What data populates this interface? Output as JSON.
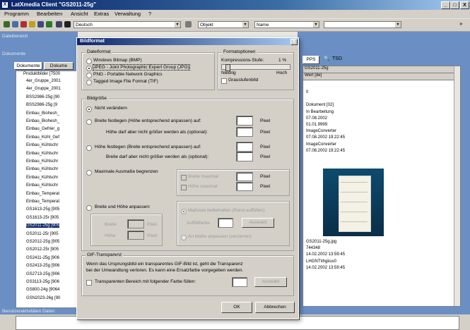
{
  "window": {
    "title": "LatXmedia Client \"GS2011-25g\"",
    "minimize": "_",
    "maximize": "□",
    "close": "X"
  },
  "menu": [
    "Programm",
    "Bearbeiten",
    "Ansicht",
    "Extras",
    "Verwaltung",
    "?"
  ],
  "toolbar": {
    "language": "Deutsch",
    "object": "Objekt",
    "name": "Name",
    "arrow": "»"
  },
  "left_panel": {
    "header1": "Dateibereich",
    "header2": "Dokumente",
    "tabs": [
      "Dokumente",
      "Dokume"
    ],
    "tree_root": "Produktbilder [7500",
    "tree_items": [
      "4er_Gruppe_2001",
      "4er_Gruppe_2001",
      "BSS2986-25g [90",
      "BSS2986-25g [9",
      "Einbau_Biohesh_",
      "Einbau_Biohesh_",
      "Einbau_Gefrier_g",
      "Einbau_Kühl_Gef",
      "Einbau_Kühlschr",
      "Einbau_Kühlschr",
      "Einbau_Kühlschr",
      "Einbau_Kühlschr",
      "Einbau_Kühlschr",
      "Einbau_Kühlschr",
      "Einbau_Temperat",
      "Einbau_Temperat",
      "GS1613-25g [905",
      "GS1613-25r [905",
      "GS2011-25g [905",
      "GS2011-25r [905",
      "GS2012-25g [905",
      "GS2012-25r [905",
      "GS2411-25g [906",
      "GS2413-25g [906",
      "GS2713-25g [906",
      "GS3113-25g [906",
      "GS800-24g [9064",
      "GSN2023-26g [90"
    ],
    "selected_index": 18
  },
  "right_panel": {
    "buttons": [
      "PPS",
      "TSD"
    ],
    "col_header_top": "GS2011-25g",
    "col_header_sub": "Wert [de]",
    "values_top": [
      "0",
      "",
      "Dokument [02]",
      "In Bearbeitung",
      "07.08.2002",
      "01.01.9999",
      "ImageConverter",
      "07.08.2002 19:22:45",
      "ImageConverter",
      "07.08.2002 19:22:45"
    ],
    "values_bottom": [
      "GS2011-25g.jpg",
      "744348",
      "14.02.2002 13:59:45",
      "LHGNT\\thgkus0",
      "14.02.2002 13:59:45"
    ]
  },
  "status_bar": {
    "label": "Benutzeraktivitäten Daten"
  },
  "dialog": {
    "title": "Bildformat",
    "close": "x",
    "dateiformat": {
      "label": "Dateiformat",
      "options": [
        "Windows Bitmap (BMP)",
        "JPEG - Joint Photographic Expert Group (JPG)",
        "PNG - Portable Network Graphics",
        "Tagged Image File Format (TIF)"
      ],
      "selected": 1
    },
    "formatoptionen": {
      "label": "Formatoptionen",
      "kompression_label": "Kompressions-Stufe:",
      "kompression_value": "1 %",
      "kompression_level": 0.05,
      "low": "Niedrig",
      "high": "Hoch",
      "graustufen": "Graustufenbild"
    },
    "bildgroesse": {
      "label": "Bildgröße",
      "nicht_veraendern": "Nicht verändern",
      "breite_festlegen": "Breite festlegen (Höhe entsprechend anpassen) auf:",
      "hoehe_max_optional": "Höhe darf aber nicht größer werden als (optional):",
      "hoehe_festlegen": "Höhe festlegen (Breite entsprechend anpassen) auf:",
      "breite_max_optional": "Breite darf aber nicht größer werden als (optional):",
      "pixel": "Pixel",
      "max_ausmasse": "Maximale Ausmaße begrenzen",
      "breite_maximal": "Breite maximal",
      "hoehe_maximal": "Höhe maximal",
      "breite_hoehe_anpassen": "Breite und Höhe anpassen:",
      "breite": "Breite",
      "hoehe": "Höhe",
      "massstab": "Maßstab beibehalten (Rand auffüllen)",
      "auffuellfarbe": "Auffüllfarbe",
      "auswahl": "Auswahl",
      "an_masse": "An Maße anpassen (verzerren)"
    },
    "gif": {
      "label": "GIF-Transparenz",
      "text1": "Wenn das Ursprungsbild ein transparentes GIF-Bild ist, geht die Transparenz",
      "text2": "bei der Umwandlung verloren. Es kann eine Ersatzfarbe vorgegeben werden.",
      "transparent": "Transparenten Bereich mit folgender Farbe füllen:",
      "auswahl": "Auswahl"
    },
    "ok": "OK",
    "abbrechen": "Abbrechen"
  }
}
